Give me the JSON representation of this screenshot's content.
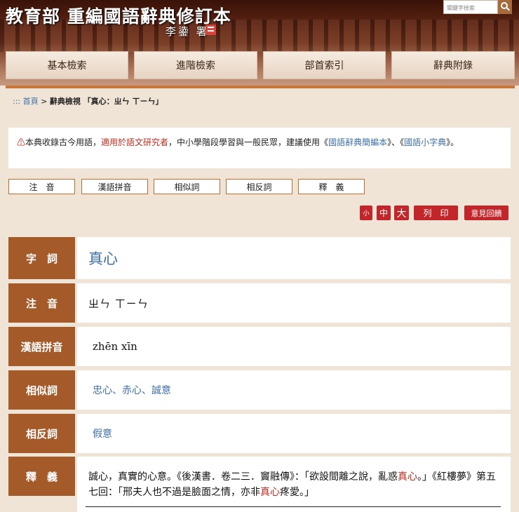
{
  "header": {
    "site_title": "教育部 重編國語辭典修訂本",
    "author": "李鍌 署",
    "search_placeholder": "關鍵字檢索"
  },
  "nav": {
    "items": [
      "基本檢索",
      "進階檢索",
      "部首索引",
      "辭典附錄"
    ]
  },
  "breadcrumb": {
    "dots": ":::",
    "home": "首頁",
    "sep": " > ",
    "current": "辭典檢視 「真心：ㄓㄣ ㄒㄧㄣ」"
  },
  "notice": {
    "icon": "⚠",
    "text1": "本典收錄古今用語，",
    "highlight": "適用於語文研究者",
    "text2": "，中小學階段學習與一般民眾，建議使用《",
    "link1": "國語辭典簡編本",
    "text3": "》、《",
    "link2": "國語小字典",
    "text4": "》。"
  },
  "sections": [
    "注　音",
    "漢語拼音",
    "相似詞",
    "相反詞",
    "釋　義"
  ],
  "tools": {
    "small": "小",
    "medium": "中",
    "large": "大",
    "print": "列　印",
    "feedback": "意見回饋"
  },
  "entry": {
    "labels": {
      "word": "字　詞",
      "zhuyin": "注　音",
      "pinyin": "漢語拼音",
      "synonyms": "相似詞",
      "antonyms": "相反詞",
      "definition": "釋　義"
    },
    "word": "真心",
    "zhuyin": "ㄓㄣ ㄒㄧㄣ",
    "pinyin": "zhēn xīn",
    "synonyms": [
      "忠心",
      "赤心",
      "誠意"
    ],
    "synonym_sep": "、",
    "antonyms": [
      "假意"
    ],
    "definition": {
      "p1": "誠心，真實的心意。《後漢書．卷二三．竇融傳》：「欲設間離之說，亂惑",
      "h1": "真心",
      "p2": "。」《紅樓夢》第五七回：「邢夫人也不過是臉面之情，亦非",
      "h2": "真心",
      "p3": "疼愛。」"
    }
  }
}
